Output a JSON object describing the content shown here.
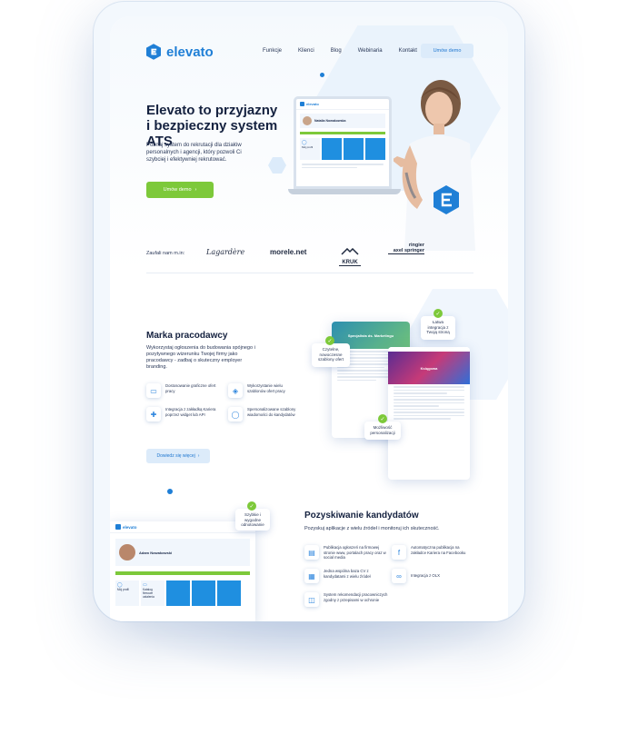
{
  "header": {
    "logo_text": "elevato",
    "nav": [
      "Funkcje",
      "Klienci",
      "Blog",
      "Webinaria",
      "Kontakt"
    ],
    "cta": "Umów demo"
  },
  "hero": {
    "title_line1": "Elevato to przyjazny",
    "title_line2": "i bezpieczny system ATS",
    "subtitle": "Poznaj system do rekrutacji dla działów personalnych i agencji, który pozwoli Ci szybciej i efektywniej rekrutować.",
    "cta": "Umów demo",
    "laptop": {
      "app_logo": "elevato",
      "candidate_name": "Natalia Nowakowska",
      "card_label": "Mój profil"
    }
  },
  "trusted": {
    "label": "Zaufali nam m.in:",
    "brands": [
      "Lagardère",
      "morele.net",
      "KRUK",
      "ringier",
      "axel springer"
    ]
  },
  "employer": {
    "title": "Marka pracodawcy",
    "subtitle": "Wykorzystaj ogłoszenia do budowania spójnego i pozytywnego wizerunku Twojej firmy jako pracodawcy - zadbaj o skuteczny employer branding.",
    "features": [
      {
        "icon": "paint-roller-icon",
        "text": "Dostosowanie graficzne ofert pracy"
      },
      {
        "icon": "layers-icon",
        "text": "Wykorzystanie wielu szablonów ofert pracy"
      },
      {
        "icon": "puzzle-icon",
        "text": "Integracja z zakładką Kariera poprzez widget lub API"
      },
      {
        "icon": "user-icon",
        "text": "Spersonalizowane szablony wiadomości do kandydatów"
      }
    ],
    "cta": "Dowiedz się więcej",
    "callouts": {
      "readable": "Czytelne, nowoczesne szablony ofert",
      "integration": "Łatwa integracja z Twoją stroną",
      "personalization": "Możliwość personalizacji"
    },
    "doc1_title": "Specjalista ds. Marketingu",
    "doc2_title": "Księgowa"
  },
  "candidates": {
    "title": "Pozyskiwanie kandydatów",
    "subtitle": "Pozyskuj aplikacje z wielu źródeł i monitoruj ich skuteczność.",
    "features": [
      {
        "icon": "doc-icon",
        "text": "Publikacja ogłoszeń na firmowej stronie www, portalach pracy oraz w social media"
      },
      {
        "icon": "facebook-icon",
        "text": "Automatyczna publikacja na zakładce Kariera na Facebooku"
      },
      {
        "icon": "grid-icon",
        "text": "Jedna wspólna baza CV z kandydatami z wielu źródeł"
      },
      {
        "icon": "olx-icon",
        "text": "Integracja z OLX"
      },
      {
        "icon": "chat-icon",
        "text": "System rekomendacji pracowniczych zgodny z przepisami w ochronie"
      }
    ],
    "callout": "Szybkie i wygodne odnotowanie",
    "app": {
      "logo": "elevato",
      "candidate_name": "Adam Nowakowski",
      "tiles": [
        "Mój profil",
        "Katalog firmowe ustalenia"
      ]
    }
  },
  "colors": {
    "brand_blue": "#1f7fd6",
    "cta_green": "#7dc93a",
    "light_button": "#dcebfa",
    "heading": "#14213f"
  }
}
